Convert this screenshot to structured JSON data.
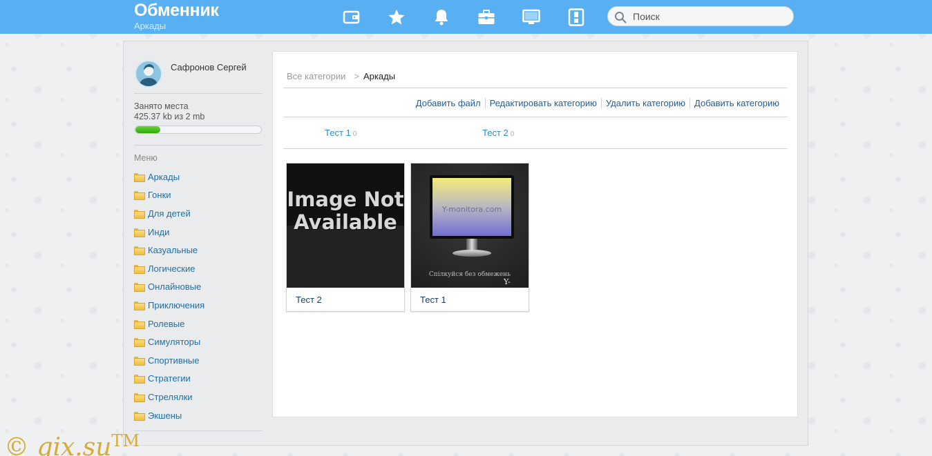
{
  "header": {
    "title": "Обменник",
    "subtitle": "Аркады",
    "nav_icons": [
      "wallet-icon",
      "star-icon",
      "bell-icon",
      "briefcase-icon",
      "monitor-icon",
      "phone-switch-icon"
    ],
    "search_placeholder": "Поиск"
  },
  "sidebar": {
    "user_name": "Сафронов Сергей",
    "quota_label": "Занято места",
    "quota_value": "425.37 kb из 2 mb",
    "quota_fraction": 0.2,
    "menu_title": "Меню",
    "menu": [
      "Аркады",
      "Гонки",
      "Для детей",
      "Инди",
      "Казуальные",
      "Логические",
      "Онлайновые",
      "Приключения",
      "Ролевые",
      "Симуляторы",
      "Спортивные",
      "Стратегии",
      "Стрелялки",
      "Экшены"
    ]
  },
  "content": {
    "breadcrumb": {
      "root": "Все категории",
      "arrow": ">",
      "current": "Аркады"
    },
    "actions": [
      "Добавить файл",
      "Редактировать категорию",
      "Удалить категорию",
      "Добавить категорию"
    ],
    "subcategories": [
      {
        "name": "Тест 1",
        "count": "0"
      },
      {
        "name": "Тест 2",
        "count": "0"
      }
    ],
    "cards": [
      {
        "title": "Тест 2",
        "thumb_text": "Image Not Available"
      },
      {
        "title": "Тест 1",
        "screen_text": "Y-monitora.com",
        "caption": "Спілкуйся без обмежень",
        "brand": "Y-monito"
      }
    ]
  },
  "watermark": {
    "text": "© gix.su",
    "mark": "TM"
  },
  "colors": {
    "header": "#58b0f2",
    "link": "#1d6fa5",
    "progress": "#3cb814",
    "watermark": "#d4ad38"
  }
}
